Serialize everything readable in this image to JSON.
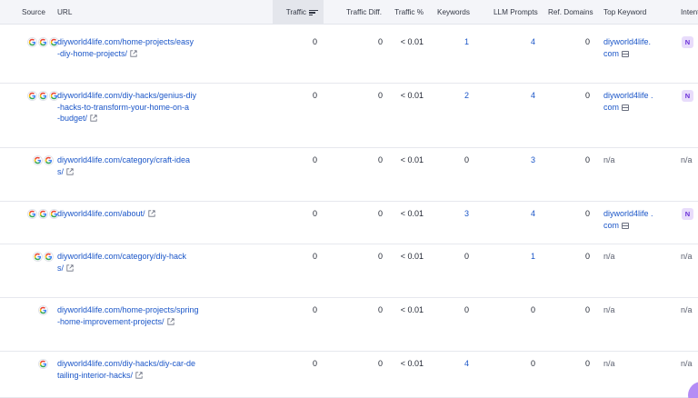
{
  "header": {
    "source": "Source",
    "url": "URL",
    "traffic": "Traffic",
    "traffic_diff": "Traffic Diff.",
    "traffic_pct": "Traffic %",
    "keywords": "Keywords",
    "llm_prompts": "LLM Prompts",
    "ref_domains": "Ref. Domains",
    "top_keyword": "Top Keyword",
    "intent": "Intent"
  },
  "icons": {
    "source": "google-icon",
    "external": "external-link-icon",
    "serp": "serp-icon",
    "sort": "sort-descending-icon"
  },
  "rows": [
    {
      "source_count": 3,
      "url_lines": [
        "diyworld4life.com/home-projects/easy",
        "-diy-home-projects/"
      ],
      "traffic": "0",
      "traffic_diff": "0",
      "traffic_pct": "< 0.01",
      "keywords": "1",
      "llm_prompts": "4",
      "ref_domains": "0",
      "top_keyword_lines": [
        "diyworld4life.",
        "com"
      ],
      "intent": "N"
    },
    {
      "source_count": 3,
      "url_lines": [
        "diyworld4life.com/diy-hacks/genius-diy",
        "-hacks-to-transform-your-home-on-a",
        "-budget/"
      ],
      "traffic": "0",
      "traffic_diff": "0",
      "traffic_pct": "< 0.01",
      "keywords": "2",
      "llm_prompts": "4",
      "ref_domains": "0",
      "top_keyword_lines": [
        "diyworld4life .",
        "com"
      ],
      "intent": "N"
    },
    {
      "source_count": 2,
      "url_lines": [
        "diyworld4life.com/category/craft-idea",
        "s/"
      ],
      "traffic": "0",
      "traffic_diff": "0",
      "traffic_pct": "< 0.01",
      "keywords": "0",
      "llm_prompts": "3",
      "ref_domains": "0",
      "top_keyword_lines": [
        "n/a"
      ],
      "intent": "n/a"
    },
    {
      "source_count": 3,
      "url_lines": [
        "diyworld4life.com/about/"
      ],
      "traffic": "0",
      "traffic_diff": "0",
      "traffic_pct": "< 0.01",
      "keywords": "3",
      "llm_prompts": "4",
      "ref_domains": "0",
      "top_keyword_lines": [
        "diyworld4life .",
        "com"
      ],
      "intent": "N"
    },
    {
      "source_count": 2,
      "url_lines": [
        "diyworld4life.com/category/diy-hack",
        "s/"
      ],
      "traffic": "0",
      "traffic_diff": "0",
      "traffic_pct": "< 0.01",
      "keywords": "0",
      "llm_prompts": "1",
      "ref_domains": "0",
      "top_keyword_lines": [
        "n/a"
      ],
      "intent": "n/a"
    },
    {
      "source_count": 1,
      "url_lines": [
        "diyworld4life.com/home-projects/spring",
        "-home-improvement-projects/"
      ],
      "traffic": "0",
      "traffic_diff": "0",
      "traffic_pct": "< 0.01",
      "keywords": "0",
      "llm_prompts": "0",
      "ref_domains": "0",
      "top_keyword_lines": [
        "n/a"
      ],
      "intent": "n/a"
    },
    {
      "source_count": 1,
      "url_lines": [
        "diyworld4life.com/diy-hacks/diy-car-de",
        "tailing-interior-hacks/"
      ],
      "traffic": "0",
      "traffic_diff": "0",
      "traffic_pct": "< 0.01",
      "keywords": "4",
      "llm_prompts": "0",
      "ref_domains": "0",
      "top_keyword_lines": [
        "n/a"
      ],
      "intent": "n/a"
    }
  ]
}
